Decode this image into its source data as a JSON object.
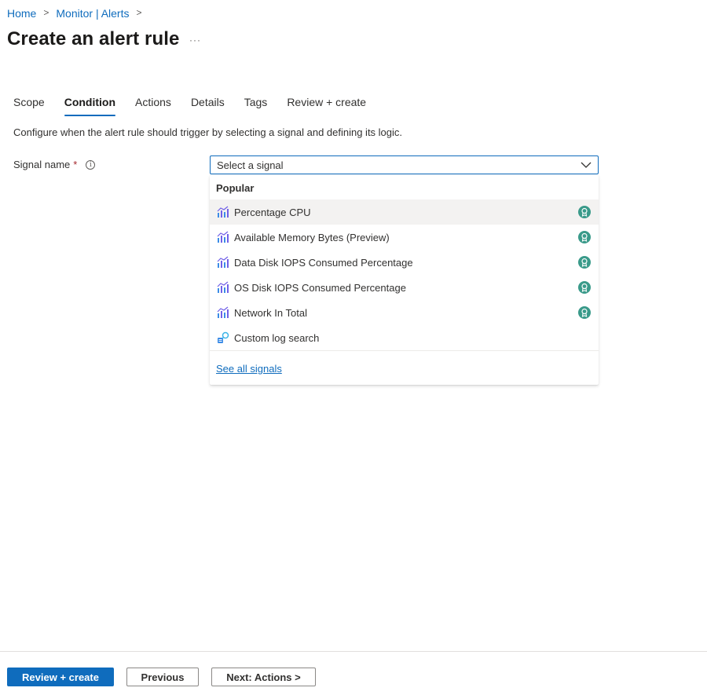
{
  "breadcrumb": {
    "items": [
      "Home",
      "Monitor | Alerts"
    ],
    "separator": ">"
  },
  "page": {
    "title": "Create an alert rule",
    "more_label": "···"
  },
  "tabs": [
    {
      "label": "Scope",
      "active": false
    },
    {
      "label": "Condition",
      "active": true
    },
    {
      "label": "Actions",
      "active": false
    },
    {
      "label": "Details",
      "active": false
    },
    {
      "label": "Tags",
      "active": false
    },
    {
      "label": "Review + create",
      "active": false
    }
  ],
  "condition": {
    "description": "Configure when the alert rule should trigger by selecting a signal and defining its logic.",
    "signal_label": "Signal name",
    "required_marker": "*",
    "info_glyph": "i",
    "select_placeholder": "Select a signal"
  },
  "dropdown": {
    "section_header": "Popular",
    "items": [
      {
        "label": "Percentage CPU",
        "icon": "metric-chart-icon",
        "recommended": true
      },
      {
        "label": "Available Memory Bytes (Preview)",
        "icon": "metric-chart-icon",
        "recommended": true
      },
      {
        "label": "Data Disk IOPS Consumed Percentage",
        "icon": "metric-chart-icon",
        "recommended": true
      },
      {
        "label": "OS Disk IOPS Consumed Percentage",
        "icon": "metric-chart-icon",
        "recommended": true
      },
      {
        "label": "Network In Total",
        "icon": "metric-chart-icon",
        "recommended": true
      },
      {
        "label": "Custom log search",
        "icon": "log-search-icon",
        "recommended": false
      }
    ],
    "see_all_label": "See all signals"
  },
  "footer": {
    "review_create_label": "Review + create",
    "previous_label": "Previous",
    "next_label": "Next: Actions >"
  },
  "colors": {
    "accent": "#0f6cbd",
    "recommended_badge": "#3a9a8a",
    "metric_icon_purple": "#7160e8",
    "metric_icon_blue": "#3c8ce7"
  }
}
